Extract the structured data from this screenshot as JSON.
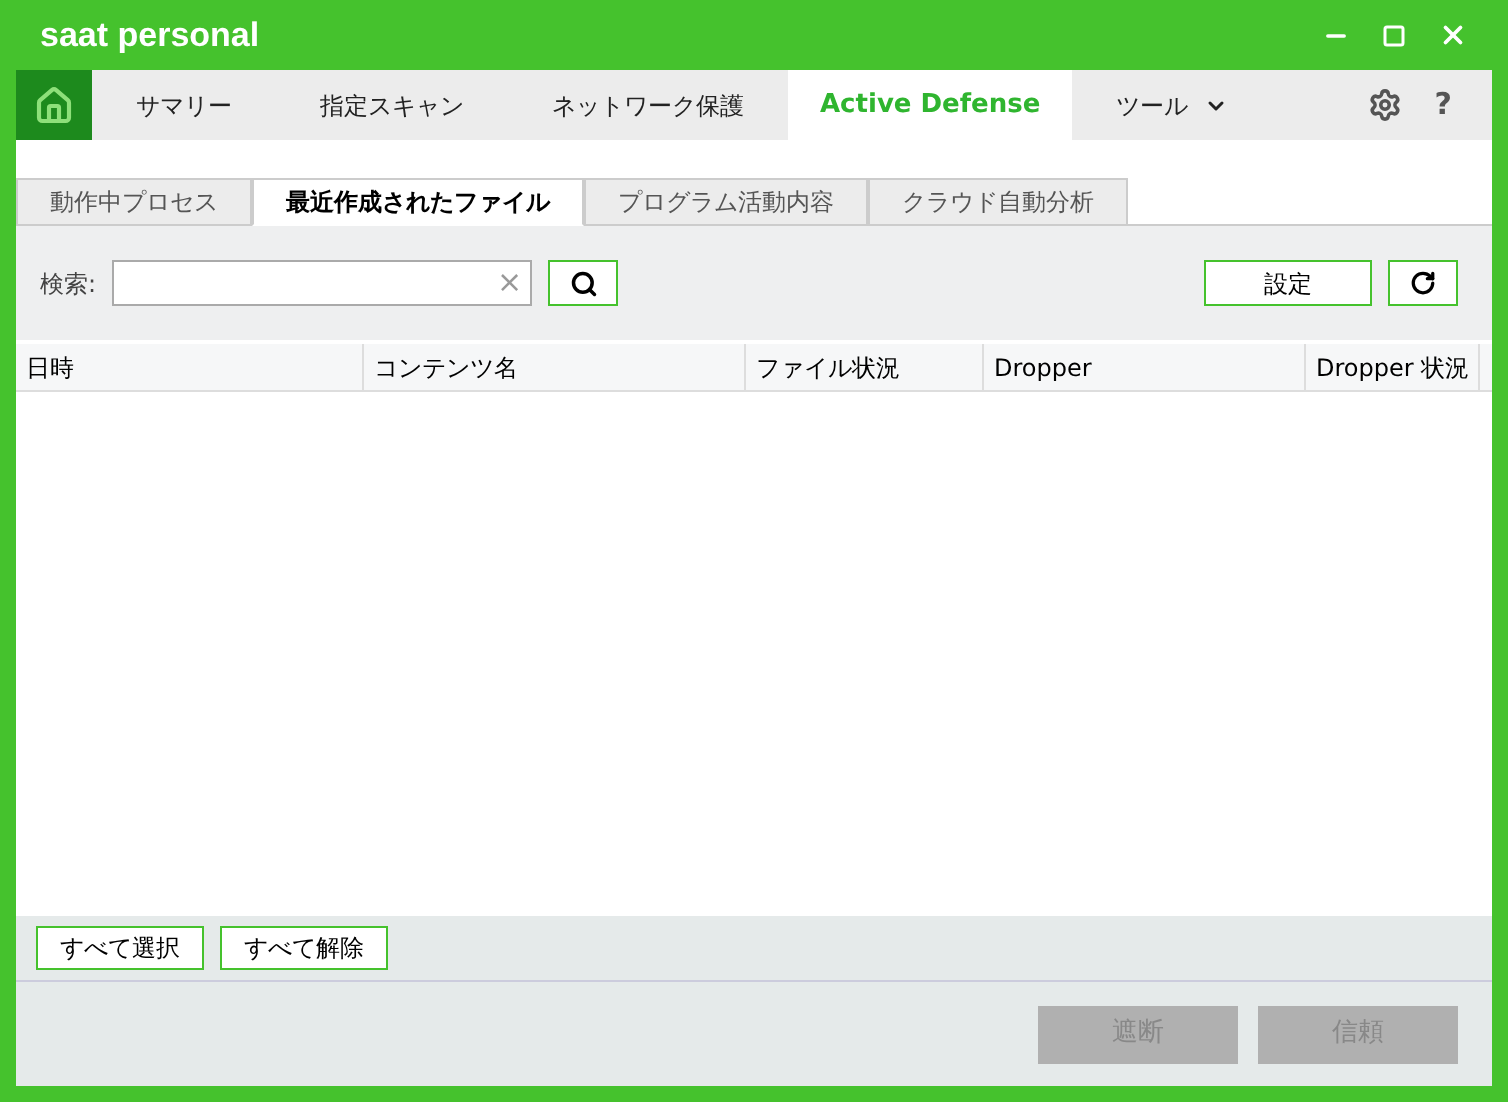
{
  "window": {
    "title": "saat personal"
  },
  "nav": [
    {
      "label": "サマリー",
      "selected": false
    },
    {
      "label": "指定スキャン",
      "selected": false
    },
    {
      "label": "ネットワーク保護",
      "selected": false
    },
    {
      "label": "Active Defense",
      "selected": true
    },
    {
      "label": "ツール",
      "selected": false,
      "kind": "menu"
    }
  ],
  "help": "?",
  "subtabs": [
    {
      "label": "動作中プロセス",
      "selected": false
    },
    {
      "label": "最近作成されたファイル",
      "selected": true
    },
    {
      "label": "プログラム活動内容",
      "selected": false
    },
    {
      "label": "クラウド自動分析",
      "selected": false
    }
  ],
  "search": {
    "label": "検索:",
    "clear": "×"
  },
  "settings_button": "設定",
  "table": {
    "columns": [
      "日時",
      "コンテンツ名",
      "ファイル状況",
      "Dropper",
      "Dropper 状況"
    ]
  },
  "select_buttons": [
    "すべて選択",
    "すべて解除"
  ],
  "actions": [
    {
      "label": "遮断",
      "disabled": true
    },
    {
      "label": "信頼",
      "disabled": true
    }
  ]
}
